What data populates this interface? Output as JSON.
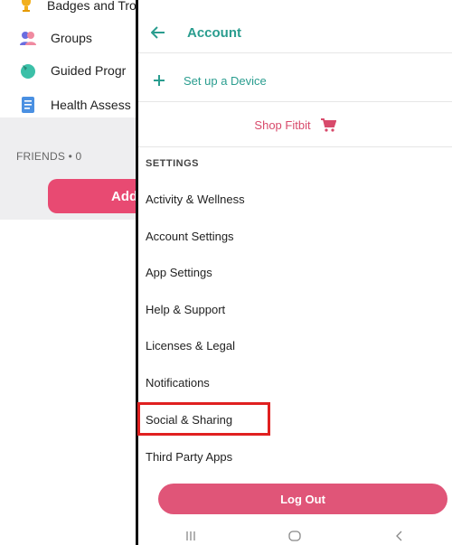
{
  "background": {
    "items": [
      {
        "label": "Badges and Trophies",
        "icon": "trophy-icon"
      },
      {
        "label": "Groups",
        "icon": "groups-icon"
      },
      {
        "label": "Guided Progr",
        "icon": "guided-programs-icon"
      },
      {
        "label": "Health Assess",
        "icon": "health-assessment-icon"
      }
    ],
    "friends_label": "FRIENDS • 0",
    "add_button_label": "Add"
  },
  "account": {
    "title": "Account",
    "setup_label": "Set up a Device",
    "shop_label": "Shop Fitbit",
    "section_label": "SETTINGS",
    "settings": [
      {
        "label": "Activity & Wellness"
      },
      {
        "label": "Account Settings"
      },
      {
        "label": "App Settings"
      },
      {
        "label": "Help & Support"
      },
      {
        "label": "Licenses & Legal"
      },
      {
        "label": "Notifications"
      },
      {
        "label": "Social & Sharing"
      },
      {
        "label": "Third Party Apps"
      }
    ],
    "logout_label": "Log Out"
  },
  "colors": {
    "teal": "#2a9d8f",
    "pink": "#e05578",
    "highlight": "#e02020"
  },
  "navbar": {
    "icons": [
      "recent-apps-icon",
      "home-icon",
      "back-nav-icon"
    ]
  }
}
